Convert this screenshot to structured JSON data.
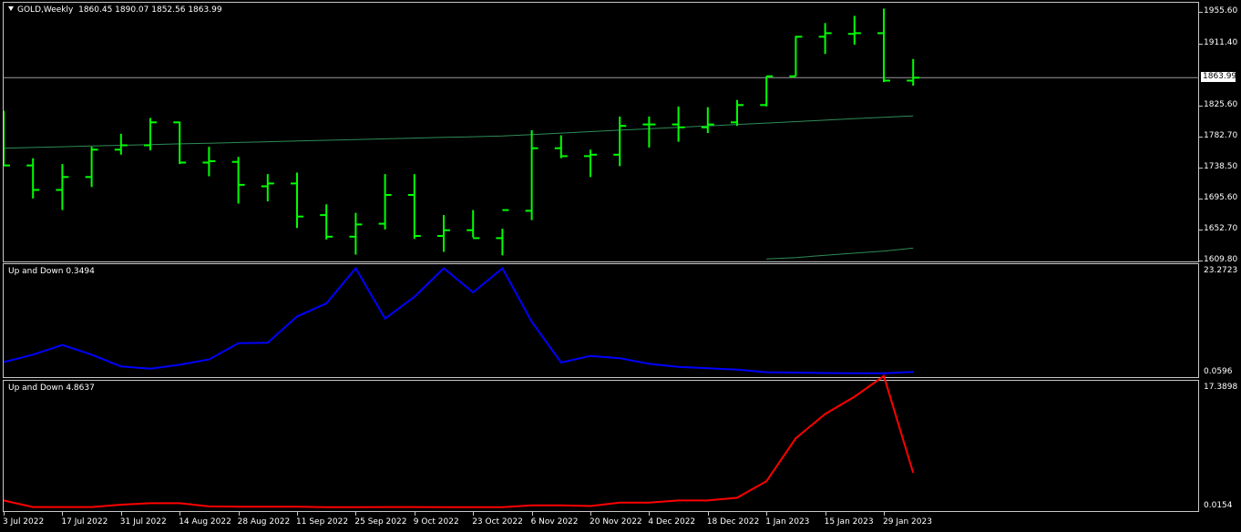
{
  "main_chart": {
    "title": "GOLD,Weekly",
    "ohlc_text": "1860.45 1890.07 1852.56 1863.99",
    "current_price_label": "1863.99",
    "price_axis_labels": [
      "1955.60",
      "1911.40",
      "1825.60",
      "1782.70",
      "1738.50",
      "1695.60",
      "1652.70",
      "1609.80"
    ],
    "bar_color": "#00ff00",
    "ma_color": "#2e8b57"
  },
  "indicator_1": {
    "title": "Up and Down 0.3494",
    "axis_labels": [
      "23.2723",
      "0.0596"
    ],
    "line_color": "#0000ff",
    "values": [
      2.6,
      4.3,
      6.5,
      4.3,
      1.6,
      1.1,
      2.0,
      3.2,
      6.9,
      7.0,
      13.0,
      16.0,
      24.0,
      12.5,
      17.5,
      24.0,
      18.5,
      24.0,
      11.8,
      2.5,
      4.0,
      3.5,
      2.2,
      1.5,
      1.2,
      0.9,
      0.3,
      0.2,
      0.1,
      0.06,
      0.06,
      0.35
    ]
  },
  "indicator_2": {
    "title": "Up and Down 4.8637",
    "axis_labels": [
      "17.3898",
      "0.0154"
    ],
    "line_color": "#ff0000",
    "values": [
      1.0,
      0.05,
      0.05,
      0.05,
      0.4,
      0.6,
      0.6,
      0.15,
      0.1,
      0.1,
      0.1,
      0.02,
      0.02,
      0.05,
      0.05,
      0.02,
      0.02,
      0.02,
      0.3,
      0.3,
      0.2,
      0.7,
      0.7,
      1.0,
      1.0,
      1.4,
      3.8,
      10.0,
      13.5,
      16.0,
      19.0,
      5.0
    ]
  },
  "time_axis_labels": [
    "3 Jul 2022",
    "17 Jul 2022",
    "31 Jul 2022",
    "14 Aug 2022",
    "28 Aug 2022",
    "11 Sep 2022",
    "25 Sep 2022",
    "9 Oct 2022",
    "23 Oct 2022",
    "6 Nov 2022",
    "20 Nov 2022",
    "4 Dec 2022",
    "18 Dec 2022",
    "1 Jan 2023",
    "15 Jan 2023",
    "29 Jan 2023"
  ],
  "chart_data": {
    "type": "ohlc",
    "title": "GOLD,Weekly",
    "x": [
      "3 Jul 2022",
      "10 Jul 2022",
      "17 Jul 2022",
      "24 Jul 2022",
      "31 Jul 2022",
      "7 Aug 2022",
      "14 Aug 2022",
      "21 Aug 2022",
      "28 Aug 2022",
      "4 Sep 2022",
      "11 Sep 2022",
      "18 Sep 2022",
      "25 Sep 2022",
      "2 Oct 2022",
      "9 Oct 2022",
      "16 Oct 2022",
      "23 Oct 2022",
      "30 Oct 2022",
      "6 Nov 2022",
      "13 Nov 2022",
      "20 Nov 2022",
      "27 Nov 2022",
      "4 Dec 2022",
      "11 Dec 2022",
      "18 Dec 2022",
      "25 Dec 2022",
      "1 Jan 2023",
      "8 Jan 2023",
      "15 Jan 2023",
      "22 Jan 2023",
      "29 Jan 2023",
      "5 Feb 2023"
    ],
    "open": [
      1812,
      1742,
      1708,
      1726,
      1764,
      1770,
      1802,
      1746,
      1747,
      1713,
      1717,
      1673,
      1643,
      1661,
      1701,
      1644,
      1652,
      1641,
      1679,
      1766,
      1755,
      1757,
      1799,
      1799,
      1795,
      1802,
      1826,
      1866,
      1921,
      1925,
      1926,
      1860
    ],
    "high": [
      1818,
      1752,
      1744,
      1768,
      1786,
      1808,
      1803,
      1768,
      1754,
      1730,
      1732,
      1688,
      1676,
      1730,
      1730,
      1673,
      1680,
      1654,
      1791,
      1784,
      1764,
      1810,
      1810,
      1824,
      1823,
      1833,
      1866,
      1922,
      1940,
      1950,
      1960,
      1890
    ],
    "low": [
      1742,
      1696,
      1680,
      1712,
      1757,
      1763,
      1744,
      1727,
      1689,
      1692,
      1655,
      1639,
      1618,
      1653,
      1640,
      1622,
      1642,
      1617,
      1666,
      1752,
      1726,
      1741,
      1767,
      1775,
      1787,
      1797,
      1824,
      1866,
      1897,
      1910,
      1858,
      1853
    ],
    "close": [
      1742,
      1708,
      1726,
      1764,
      1770,
      1802,
      1746,
      1748,
      1715,
      1717,
      1671,
      1643,
      1660,
      1701,
      1644,
      1652,
      1641,
      1680,
      1766,
      1755,
      1757,
      1797,
      1799,
      1795,
      1799,
      1826,
      1866,
      1921,
      1926,
      1926,
      1860,
      1864
    ],
    "series": [
      {
        "name": "",
        "values": [
          1766,
          1767,
          1768,
          1769,
          1770,
          1771,
          1772,
          1773,
          1774,
          1775,
          1776,
          1777,
          1778,
          1779,
          1780,
          1781,
          1782,
          1783,
          1785,
          1787,
          1789,
          1791,
          1793,
          1795,
          1797,
          1799,
          1801,
          1803,
          1805,
          1807,
          1809,
          1811
        ]
      },
      {
        "name": "",
        "values": [
          null,
          null,
          null,
          null,
          null,
          null,
          null,
          null,
          null,
          null,
          null,
          null,
          null,
          null,
          null,
          null,
          null,
          null,
          null,
          null,
          null,
          null,
          null,
          null,
          null,
          null,
          1612,
          1614,
          1617,
          1620,
          1623,
          1627
        ]
      }
    ],
    "ylim": [
      1609.8,
      1967.0
    ],
    "grid": false
  }
}
